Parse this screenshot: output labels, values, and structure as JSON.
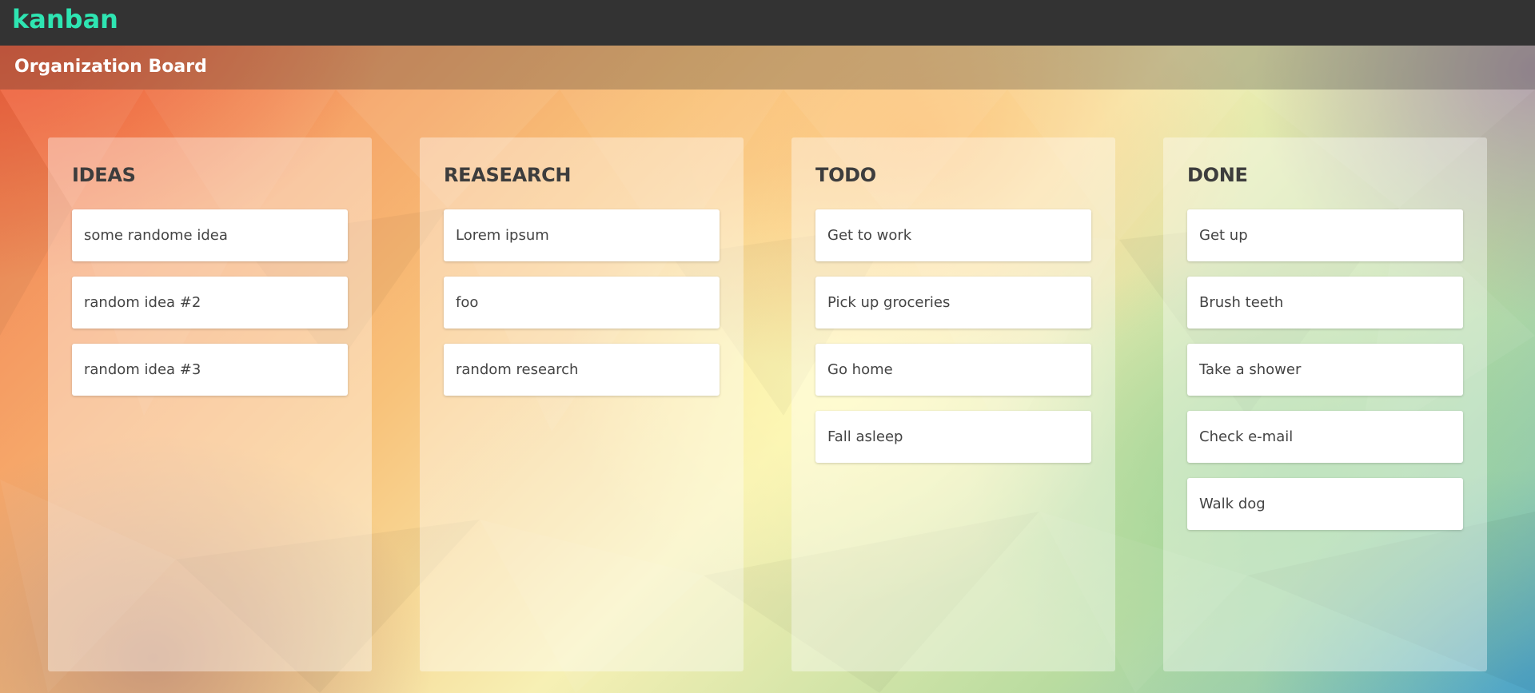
{
  "header": {
    "brand": "kanban",
    "brand_color": "#2ee5b2"
  },
  "board": {
    "title": "Organization Board"
  },
  "columns": [
    {
      "title": "IDEAS",
      "cards": [
        "some randome idea",
        "random idea #2",
        "random idea #3"
      ]
    },
    {
      "title": "REASEARCH",
      "cards": [
        "Lorem ipsum",
        "foo",
        "random research"
      ]
    },
    {
      "title": "TODO",
      "cards": [
        "Get to work",
        "Pick up groceries",
        "Go home",
        "Fall asleep"
      ]
    },
    {
      "title": "DONE",
      "cards": [
        "Get up",
        "Brush teeth",
        "Take a shower",
        "Check e-mail",
        "Walk dog"
      ]
    }
  ],
  "colors": {
    "topbar": "#333333",
    "card": "#ffffff",
    "card_text": "#444444",
    "column_title": "#3d3d3d"
  }
}
